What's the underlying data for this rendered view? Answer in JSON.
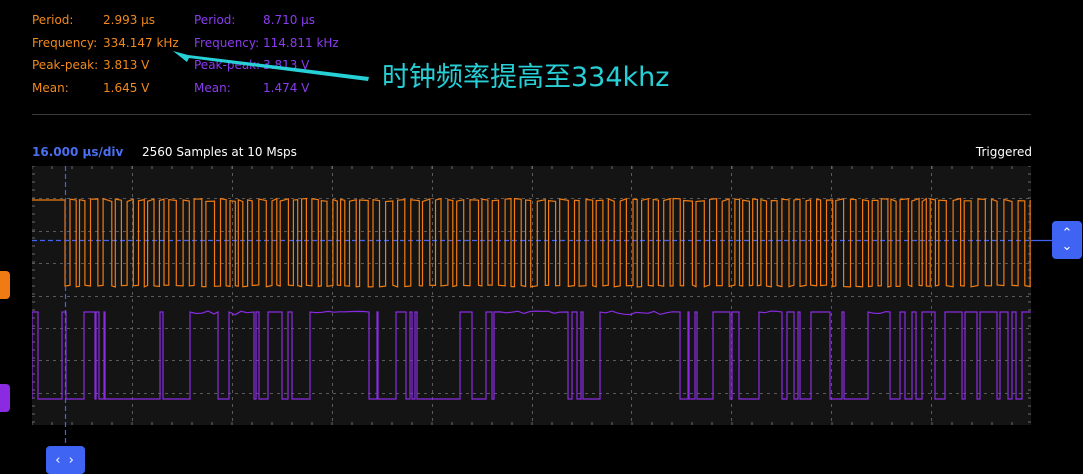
{
  "measurements": {
    "channel1": [
      {
        "label": "Period:",
        "value": "2.993 μs"
      },
      {
        "label": "Frequency:",
        "value": "334.147 kHz"
      },
      {
        "label": "Peak-peak:",
        "value": "3.813 V"
      },
      {
        "label": "Mean:",
        "value": "1.645 V"
      }
    ],
    "channel2": [
      {
        "label": "Period:",
        "value": "8.710 μs"
      },
      {
        "label": "Frequency:",
        "value": "114.811 kHz"
      },
      {
        "label": "Peak-peak:",
        "value": "3.813 V"
      },
      {
        "label": "Mean:",
        "value": "1.474 V"
      }
    ]
  },
  "annotation": {
    "text": "时钟频率提高至334khz"
  },
  "status": {
    "timebase": "16.000 μs/div",
    "samples": "2560 Samples at 10 Msps",
    "trigger": "Triggered"
  },
  "colors": {
    "channel1": "#f07b12",
    "channel2": "#8a2be2",
    "annotation": "#27d0d6",
    "accent": "#3f63f2"
  },
  "controls": {
    "vertical_up": "⌃",
    "vertical_down": "⌄",
    "horizontal": "‹ ›"
  },
  "icons": {
    "vertical-scroll-button": "chevron-up-down-icon",
    "horizontal-scroll-button": "chevron-left-right-icon"
  }
}
